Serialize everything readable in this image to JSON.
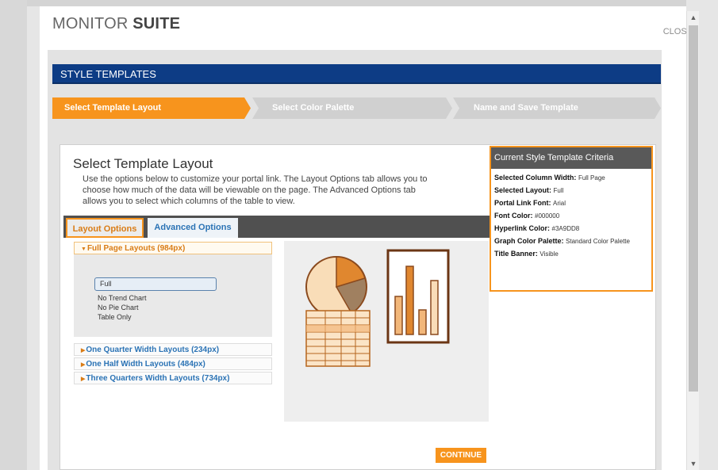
{
  "app": {
    "brand_light": "MONITOR",
    "brand_bold": "SUITE",
    "close_label": "CLOSE"
  },
  "section_title": "STYLE TEMPLATES",
  "steps": [
    "Select Template Layout",
    "Select Color Palette",
    "Name and Save Template"
  ],
  "panel": {
    "title": "Select Template Layout",
    "description": "Use the options below to customize your portal link. The Layout Options tab allows you to choose how much of the data will be viewable on the page. The Advanced Options tab allows you to select which columns of the table to view.",
    "tabs": [
      "Layout Options",
      "Advanced Options"
    ],
    "accordion": {
      "open_group": "Full Page Layouts (984px)",
      "options": [
        "Full",
        "No Trend Chart",
        "No Pie Chart",
        "Table Only"
      ],
      "selected_option": "Full",
      "closed_groups": [
        "One Quarter Width Layouts (234px)",
        "One Half Width Layouts (484px)",
        "Three Quarters Width Layouts (734px)"
      ]
    },
    "continue_label": "CONTINUE"
  },
  "criteria": {
    "title": "Current Style Template Criteria",
    "rows": [
      {
        "label": "Selected Column Width:",
        "value": "Full Page"
      },
      {
        "label": "Selected Layout:",
        "value": "Full"
      },
      {
        "label": "Portal Link Font:",
        "value": "Arial"
      },
      {
        "label": "Font Color:",
        "value": "#000000"
      },
      {
        "label": "Hyperlink Color:",
        "value": "#3A9DD8"
      },
      {
        "label": "Graph Color Palette:",
        "value": "Standard Color Palette"
      },
      {
        "label": "Title Banner:",
        "value": "Visible"
      }
    ]
  },
  "colors": {
    "accent": "#f7941d",
    "banner": "#0d3c85",
    "link": "#2b73b5"
  },
  "icons": [
    "pie-chart-icon",
    "bar-chart-icon",
    "table-icon",
    "scroll-up-icon",
    "scroll-down-icon"
  ]
}
